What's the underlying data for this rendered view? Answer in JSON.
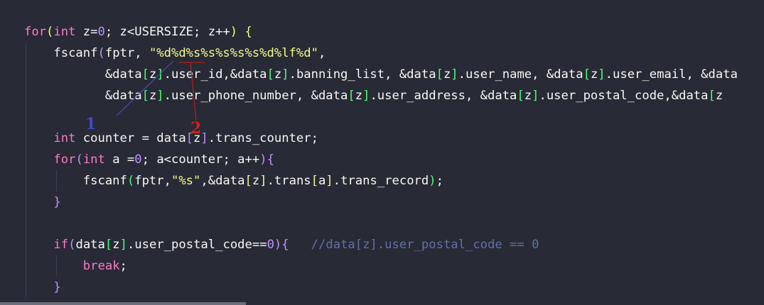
{
  "editor": {
    "lines": [
      {
        "tokens": [
          {
            "t": "for",
            "c": "kw"
          },
          {
            "t": "(",
            "c": "p1"
          },
          {
            "t": "int",
            "c": "kw"
          },
          {
            "t": " z=",
            "c": "id"
          },
          {
            "t": "0",
            "c": "num"
          },
          {
            "t": "; z<USERSIZE; z++",
            "c": "id"
          },
          {
            "t": ")",
            "c": "p1"
          },
          {
            "t": " {",
            "c": "p1"
          }
        ]
      },
      {
        "tokens": [
          {
            "t": "    fscanf",
            "c": "id"
          },
          {
            "t": "(",
            "c": "p2"
          },
          {
            "t": "fptr, ",
            "c": "id"
          },
          {
            "t": "\"%d%d%s%s%s%s%s%d%lf%d\"",
            "c": "str"
          },
          {
            "t": ",",
            "c": "id"
          }
        ]
      },
      {
        "tokens": [
          {
            "t": "           &data",
            "c": "id"
          },
          {
            "t": "[",
            "c": "p3"
          },
          {
            "t": "z",
            "c": "id"
          },
          {
            "t": "]",
            "c": "p3"
          },
          {
            "t": ".user_id,&data",
            "c": "id"
          },
          {
            "t": "[",
            "c": "p3"
          },
          {
            "t": "z",
            "c": "id"
          },
          {
            "t": "]",
            "c": "p3"
          },
          {
            "t": ".banning_list, &data",
            "c": "id"
          },
          {
            "t": "[",
            "c": "p3"
          },
          {
            "t": "z",
            "c": "id"
          },
          {
            "t": "]",
            "c": "p3"
          },
          {
            "t": ".user_name, &data",
            "c": "id"
          },
          {
            "t": "[",
            "c": "p3"
          },
          {
            "t": "z",
            "c": "id"
          },
          {
            "t": "]",
            "c": "p3"
          },
          {
            "t": ".user_email, &data",
            "c": "id"
          }
        ]
      },
      {
        "tokens": [
          {
            "t": "           &data",
            "c": "id"
          },
          {
            "t": "[",
            "c": "p3"
          },
          {
            "t": "z",
            "c": "id"
          },
          {
            "t": "]",
            "c": "p3"
          },
          {
            "t": ".user_phone_number, &data",
            "c": "id"
          },
          {
            "t": "[",
            "c": "p3"
          },
          {
            "t": "z",
            "c": "id"
          },
          {
            "t": "]",
            "c": "p3"
          },
          {
            "t": ".user_address, &data",
            "c": "id"
          },
          {
            "t": "[",
            "c": "p3"
          },
          {
            "t": "z",
            "c": "id"
          },
          {
            "t": "]",
            "c": "p3"
          },
          {
            "t": ".user_postal_code,&data",
            "c": "id"
          },
          {
            "t": "[",
            "c": "p3"
          },
          {
            "t": "z",
            "c": "id"
          }
        ]
      },
      {
        "tokens": []
      },
      {
        "tokens": [
          {
            "t": "    ",
            "c": "id"
          },
          {
            "t": "int",
            "c": "kw"
          },
          {
            "t": " counter = data",
            "c": "id"
          },
          {
            "t": "[",
            "c": "p2"
          },
          {
            "t": "z",
            "c": "id"
          },
          {
            "t": "]",
            "c": "p2"
          },
          {
            "t": ".trans_counter;",
            "c": "id"
          }
        ]
      },
      {
        "tokens": [
          {
            "t": "    ",
            "c": "id"
          },
          {
            "t": "for",
            "c": "kw"
          },
          {
            "t": "(",
            "c": "p2"
          },
          {
            "t": "int",
            "c": "kw"
          },
          {
            "t": " a =",
            "c": "id"
          },
          {
            "t": "0",
            "c": "num"
          },
          {
            "t": "; a<counter; a++",
            "c": "id"
          },
          {
            "t": ")",
            "c": "p2"
          },
          {
            "t": "{",
            "c": "p2"
          }
        ]
      },
      {
        "tokens": [
          {
            "t": "        fscanf",
            "c": "id"
          },
          {
            "t": "(",
            "c": "p3"
          },
          {
            "t": "fptr,",
            "c": "id"
          },
          {
            "t": "\"%s\"",
            "c": "str"
          },
          {
            "t": ",&data",
            "c": "id"
          },
          {
            "t": "[",
            "c": "p1"
          },
          {
            "t": "z",
            "c": "id"
          },
          {
            "t": "]",
            "c": "p1"
          },
          {
            "t": ".trans",
            "c": "id"
          },
          {
            "t": "[",
            "c": "p1"
          },
          {
            "t": "a",
            "c": "id"
          },
          {
            "t": "]",
            "c": "p1"
          },
          {
            "t": ".trans_record",
            "c": "id"
          },
          {
            "t": ")",
            "c": "p3"
          },
          {
            "t": ";",
            "c": "id"
          }
        ]
      },
      {
        "tokens": [
          {
            "t": "    ",
            "c": "id"
          },
          {
            "t": "}",
            "c": "p2"
          }
        ]
      },
      {
        "tokens": []
      },
      {
        "tokens": [
          {
            "t": "    ",
            "c": "id"
          },
          {
            "t": "if",
            "c": "kw"
          },
          {
            "t": "(",
            "c": "p2"
          },
          {
            "t": "data",
            "c": "id"
          },
          {
            "t": "[",
            "c": "p3"
          },
          {
            "t": "z",
            "c": "id"
          },
          {
            "t": "]",
            "c": "p3"
          },
          {
            "t": ".user_postal_code==",
            "c": "id"
          },
          {
            "t": "0",
            "c": "num"
          },
          {
            "t": ")",
            "c": "p2"
          },
          {
            "t": "{",
            "c": "p2"
          },
          {
            "t": "   //data[z].user_postal_code == 0",
            "c": "cm"
          }
        ]
      },
      {
        "tokens": [
          {
            "t": "        ",
            "c": "id"
          },
          {
            "t": "break",
            "c": "kw"
          },
          {
            "t": ";",
            "c": "id"
          }
        ]
      },
      {
        "tokens": [
          {
            "t": "    ",
            "c": "id"
          },
          {
            "t": "}",
            "c": "p2"
          }
        ]
      }
    ]
  },
  "annotations": {
    "label_1": "1",
    "label_2": "2",
    "label_1_color": "#3f4bc7",
    "label_2_color": "#d21f1f"
  },
  "colors": {
    "background": "#282a36",
    "keyword": "#ff79c6",
    "string": "#f1fa8c",
    "number": "#bd93f9",
    "comment": "#6272a4"
  }
}
